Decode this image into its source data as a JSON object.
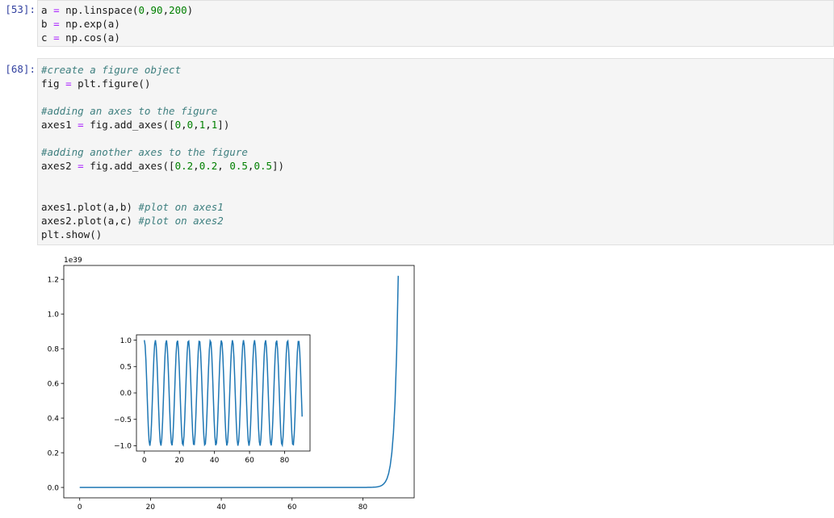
{
  "cells": [
    {
      "prompt": "[53]:",
      "lines": [
        "a = np.linspace(0,90,200)",
        "b = np.exp(a)",
        "c = np.cos(a)"
      ]
    },
    {
      "prompt": "[68]:",
      "lines": [
        "#create a figure object",
        "fig = plt.figure()",
        "",
        "#adding an axes to the figure",
        "axes1 = fig.add_axes([0,0,1,1])",
        "",
        "#adding another axes to the figure",
        "axes2 = fig.add_axes([0.2,0.2, 0.5,0.5])",
        "",
        "",
        "axes1.plot(a,b) #plot on axes1",
        "axes2.plot(a,c) #plot on axes2",
        "plt.show()"
      ]
    }
  ],
  "chart_data": [
    {
      "type": "line",
      "name": "axes1",
      "x_range": [
        0,
        90
      ],
      "function": "exp",
      "xlim": [
        -4.5,
        94.5
      ],
      "ylim": [
        -6e+37,
        1.28e+39
      ],
      "offset_text": "1e39",
      "xticks": [
        0,
        20,
        40,
        60,
        80
      ],
      "xtick_labels": [
        "0",
        "20",
        "40",
        "60",
        "80"
      ],
      "yticks": [
        0,
        0.2,
        0.4,
        0.6,
        0.8,
        1.0,
        1.2
      ],
      "ytick_labels": [
        "0.0",
        "0.2",
        "0.4",
        "0.6",
        "0.8",
        "1.0",
        "1.2"
      ],
      "grid": false,
      "line_color": "#1f77b4"
    },
    {
      "type": "line",
      "name": "axes2",
      "x_range": [
        0,
        90
      ],
      "function": "cos",
      "xlim": [
        -4.5,
        94.5
      ],
      "ylim": [
        -1.1,
        1.1
      ],
      "xticks": [
        0,
        20,
        40,
        60,
        80
      ],
      "xtick_labels": [
        "0",
        "20",
        "40",
        "60",
        "80"
      ],
      "yticks": [
        -1.0,
        -0.5,
        0.0,
        0.5,
        1.0
      ],
      "ytick_labels": [
        "−1.0",
        "−0.5",
        "0.0",
        "0.5",
        "1.0"
      ],
      "grid": false,
      "line_color": "#1f77b4"
    }
  ]
}
